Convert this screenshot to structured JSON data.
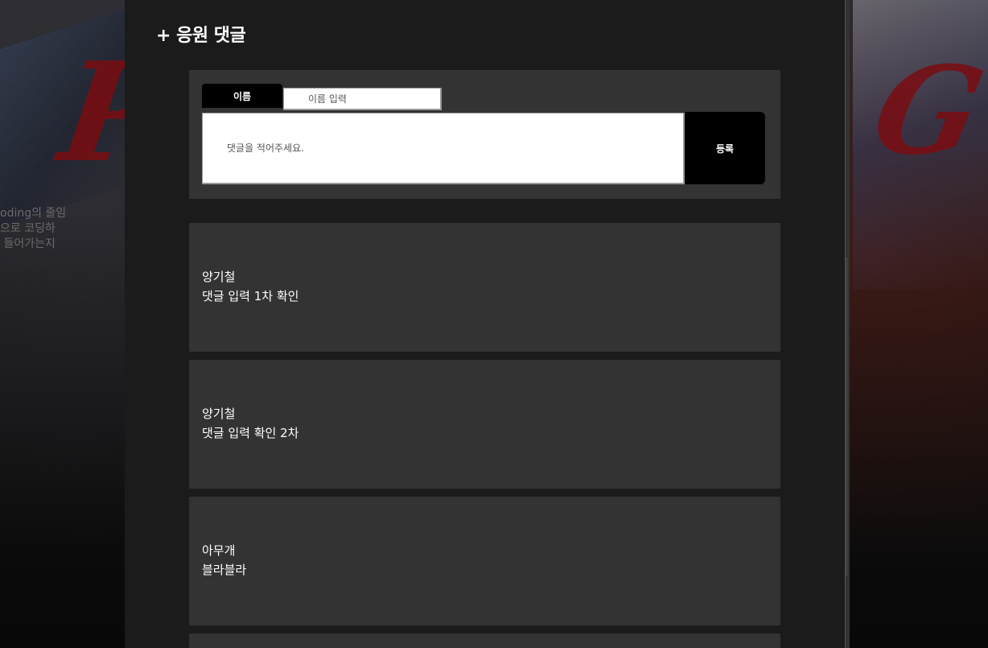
{
  "background": {
    "blurred_text_lines": [
      "oding의 줄임",
      "으로 코딩하",
      " 들어가는지"
    ]
  },
  "section": {
    "title": "+ 응원 댓글"
  },
  "form": {
    "name_label": "이름",
    "name_placeholder": "이름 입력",
    "comment_placeholder": "댓글을 적어주세요.",
    "submit_label": "등록"
  },
  "comments": [
    {
      "author": "양기철",
      "text": "댓글 입력 1차 확인"
    },
    {
      "author": "양기철",
      "text": "댓글 입력 확인 2차"
    },
    {
      "author": "아무개",
      "text": "블라블라"
    }
  ],
  "colors": {
    "panel": "#1b1b1b",
    "card": "#333333",
    "button": "#000000",
    "poster_accent": "#7a0d12"
  }
}
